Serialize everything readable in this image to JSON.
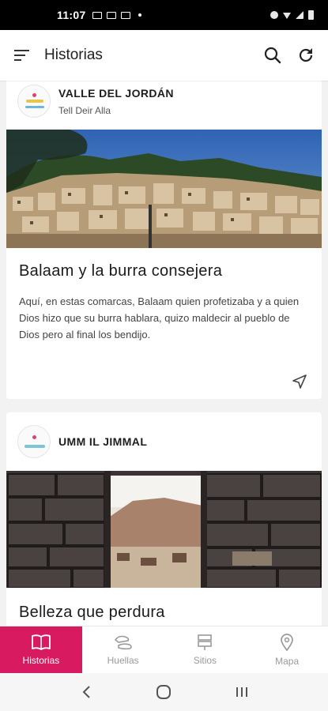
{
  "status_bar": {
    "time": "11:07"
  },
  "app_bar": {
    "title": "Historias"
  },
  "cards": [
    {
      "place": "VALLE DEL JORDÁN",
      "subplace": "Tell Deir Alla",
      "title": "Balaam y la burra consejera",
      "description": "Aquí, en estas comarcas, Balaam quien profetizaba y a quien Dios hizo que su burra hablara, quizo maldecir al pueblo de Dios pero al final los bendijo."
    },
    {
      "place": "UMM IL JIMMAL",
      "subplace": "",
      "title": "Belleza que perdura",
      "description": ""
    }
  ],
  "bottom_nav": [
    {
      "label": "Historias",
      "icon": "book-icon",
      "active": true
    },
    {
      "label": "Huellas",
      "icon": "footprints-icon",
      "active": false
    },
    {
      "label": "Sitios",
      "icon": "signpost-icon",
      "active": false
    },
    {
      "label": "Mapa",
      "icon": "map-pin-icon",
      "active": false
    }
  ],
  "colors": {
    "accent": "#d81b60",
    "sky": "#3f6fb5"
  }
}
